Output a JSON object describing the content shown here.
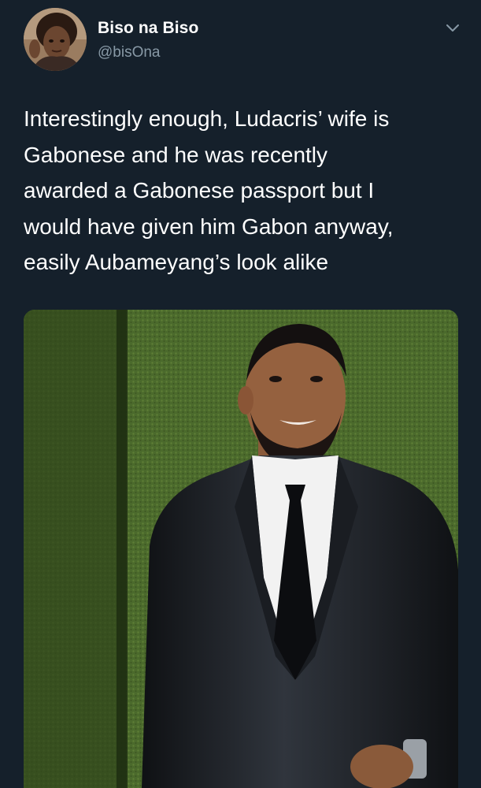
{
  "author": {
    "display_name": "Biso na Biso",
    "handle": "@bisOna",
    "avatar_icon": "profile-photo"
  },
  "tweet": {
    "text": "Interestingly enough, Ludacris’ wife is\nGabonese and he was recently\nawarded a Gabonese passport but I\nwould have given him Gabon anyway,\neasily Aubameyang’s look alike"
  },
  "menu_icon": "chevron-down-icon",
  "colors": {
    "background": "#15202b",
    "primary_text": "#ffffff",
    "secondary_text": "#8899a6"
  },
  "media": {
    "description_icon": "photo-man-in-suit"
  }
}
